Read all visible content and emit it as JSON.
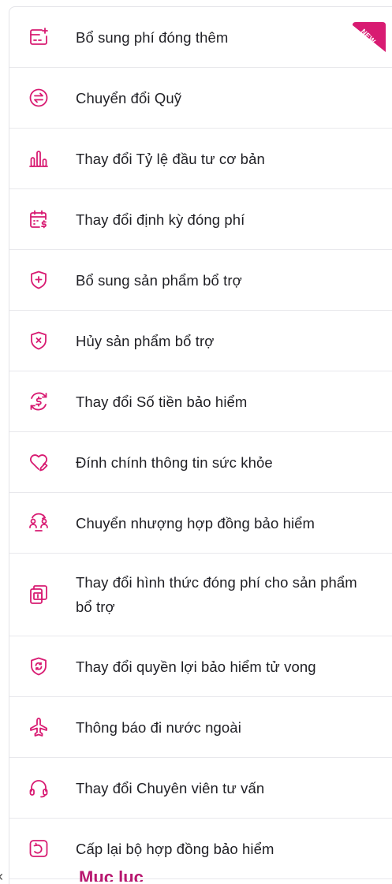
{
  "accent_color": "#d81b72",
  "badge": {
    "text": "NEW",
    "color": "#d81b72"
  },
  "menu": {
    "items": [
      {
        "label": "Bổ sung phí đóng thêm",
        "icon": "add-premium-icon"
      },
      {
        "label": "Chuyển đổi Quỹ",
        "icon": "fund-switch-icon"
      },
      {
        "label": "Thay đổi Tỷ lệ đầu tư cơ bản",
        "icon": "bar-chart-icon"
      },
      {
        "label": "Thay đổi định kỳ đóng phí",
        "icon": "calendar-payment-icon"
      },
      {
        "label": "Bổ sung sản phẩm bổ trợ",
        "icon": "shield-plus-icon"
      },
      {
        "label": "Hủy sản phẩm bổ trợ",
        "icon": "shield-x-icon"
      },
      {
        "label": "Thay đổi Số tiền bảo hiểm",
        "icon": "money-refresh-icon"
      },
      {
        "label": "Đính chính thông tin sức khỏe",
        "icon": "heart-edit-icon"
      },
      {
        "label": "Chuyển nhượng hợp đồng bảo hiểm",
        "icon": "transfer-people-icon"
      },
      {
        "label": "Thay đổi hình thức đóng phí cho sản phẩm bổ trợ",
        "icon": "payment-method-icon"
      },
      {
        "label": "Thay đổi quyền lợi bảo hiểm tử vong",
        "icon": "shield-refresh-icon"
      },
      {
        "label": "Thông báo đi nước ngoài",
        "icon": "airplane-icon"
      },
      {
        "label": "Thay đổi Chuyên viên tư vấn",
        "icon": "headset-icon"
      },
      {
        "label": "Cấp lại bộ hợp đồng bảo hiểm",
        "icon": "document-reissue-icon"
      }
    ]
  },
  "footer": {
    "chevron": "‹",
    "title": "Mục lục"
  }
}
